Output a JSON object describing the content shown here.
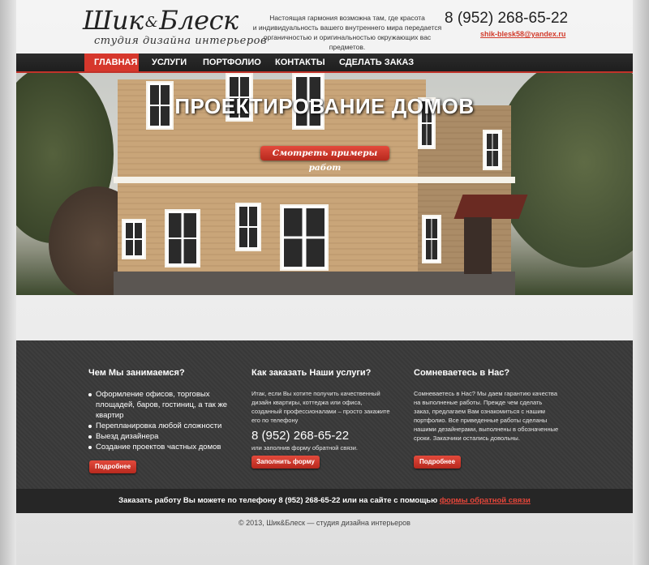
{
  "header": {
    "logo_main": "Шик",
    "logo_amp": "&",
    "logo_main2": "Блеск",
    "logo_sub": "студия дизайна интерьеров",
    "tagline_1": "Настоящая гармония возможна там, где красота",
    "tagline_2": "и индивидуальность вашего внутреннего мира передается",
    "tagline_3": "органичностью и оригинальностью окружающих вас предметов.",
    "phone": "8 (952) 268-65-22",
    "email": "shik-blesk58@yandex.ru"
  },
  "nav": {
    "items": [
      {
        "label": "ГЛАВНАЯ"
      },
      {
        "label": "УСЛУГИ"
      },
      {
        "label": "ПОРТФОЛИО"
      },
      {
        "label": "КОНТАКТЫ"
      },
      {
        "label": "СДЕЛАТЬ ЗАКАЗ"
      }
    ],
    "active_index": 0
  },
  "hero": {
    "title": "ПРОЕКТИРОВАНИЕ ДОМОВ",
    "button_label": "Смотреть примеры работ",
    "thumbnail_count": 6,
    "active_thumbnail": 2
  },
  "columns": [
    {
      "title": "Чем Мы занимаемся?",
      "items": [
        "Оформление офисов, торговых площадей, баров, гостиниц, а так же квартир",
        "Перепланировка любой сложности",
        "Выезд дизайнера",
        "Создание проектов частных домов"
      ],
      "button_label": "Подробнее"
    },
    {
      "title": "Как заказать Наши услуги?",
      "text": "Итак, если Вы хотите получить качественный дизайн квартиры, коттеджа или офиса, созданный профессионалами – просто закажите его по телефону",
      "phone": "8 (952) 268-65-22",
      "small": "или заполнив форму обратной связи.",
      "button_label": "Заполнить форму"
    },
    {
      "title": "Сомневаетесь в Нас?",
      "text": "Сомневаетесь в Нас? Мы даем гарантию качества на выполненые работы. Прежде чем сделать заказ, предлагаем Вам ознакомиться с нашим портфолио. Все приведенные работы сделаны нашими дезайнерами, выполнены в обозначенные сроки. Заказчики остались довольны.",
      "button_label": "Подробнее"
    }
  ],
  "order_bar": {
    "text": "Заказать работу Вы можете по телефону 8 (952) 268-65-22 или на сайте с помощью ",
    "link": "формы обратной связи"
  },
  "footer": {
    "copyright": "© 2013, Шик&Блеск — студия дизайна интерьеров"
  },
  "colors": {
    "accent": "#d6372c",
    "nav_bg": "#262626",
    "info_bg": "#3a3a3a"
  }
}
